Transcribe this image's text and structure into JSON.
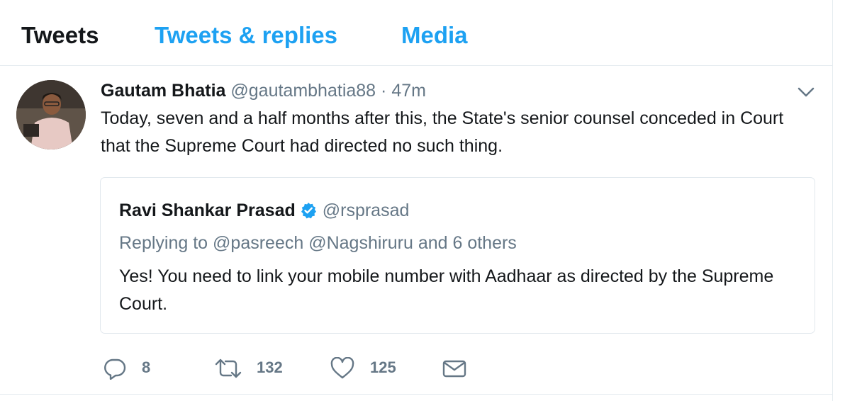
{
  "tabs": [
    {
      "label": "Tweets"
    },
    {
      "label": "Tweets & replies"
    },
    {
      "label": "Media"
    }
  ],
  "tweet": {
    "author_name": "Gautam Bhatia",
    "author_handle": "@gautambhatia88",
    "separator": "·",
    "time": "47m",
    "text": "Today, seven and a half months after this, the State's senior counsel conceded in Court that the Supreme Court had directed no such thing.",
    "menu_icon": "chevron-down-icon",
    "avatar": "profile-photo"
  },
  "quoted": {
    "author_name": "Ravi Shankar Prasad",
    "verified_icon": "verified-badge-icon",
    "author_handle": "@rsprasad",
    "reply_prefix": "Replying to",
    "reply_to": "@pasreech @Nagshiruru",
    "reply_suffix": "and 6 others",
    "text": "Yes! You need to link your mobile number with Aadhaar as directed by the Supreme Court."
  },
  "actions": {
    "reply_count": "8",
    "retweet_count": "132",
    "like_count": "125",
    "icons": [
      "reply-icon",
      "retweet-icon",
      "like-icon",
      "direct-message-icon"
    ]
  },
  "colors": {
    "accent": "#1da1f2",
    "text": "#14171a",
    "secondary": "#657786",
    "border": "#e6ecf0"
  }
}
